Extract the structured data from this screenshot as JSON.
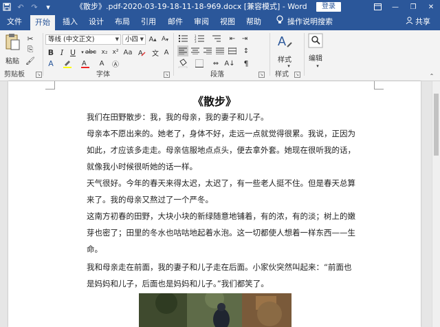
{
  "titlebar": {
    "title": "《散步》.pdf-2020-03-19-18-11-18-969.docx [兼容模式] - Word",
    "login_label": "登录",
    "colors": {
      "brand": "#2b579a"
    }
  },
  "tabs": [
    "文件",
    "开始",
    "插入",
    "设计",
    "布局",
    "引用",
    "邮件",
    "审阅",
    "视图",
    "帮助"
  ],
  "tell_me": "操作说明搜索",
  "share": "共享",
  "ribbon": {
    "clipboard": {
      "paste": "粘贴",
      "label": "剪贴板"
    },
    "font": {
      "name": "等线 (中文正文)",
      "size": "小四",
      "label": "字体"
    },
    "paragraph": {
      "label": "段落"
    },
    "styles": {
      "button": "样式",
      "label": "样式"
    },
    "editing": {
      "button": "编辑"
    }
  },
  "document": {
    "title": "《散步》",
    "paragraphs": [
      "我们在田野散步：我，我的母亲，我的妻子和儿子。",
      "母亲本不愿出来的。她老了，身体不好，走远一点就觉得很累。我说，正因为如此，才应该多走走。母亲信服地点点头，便去拿外套。她现在很听我的话，就像我小时候很听她的话一样。",
      "天气很好。今年的春天来得太迟，太迟了，有一些老人挺不住。但是春天总算来了。我的母亲又熬过了一个严冬。",
      "这南方初春的田野，大块小块的新绿随意地铺着，有的浓，有的淡；树上的嫩芽也密了；田里的冬水也咕咕地起着水泡。这一切都使人想着一样东西——生命。",
      "我和母亲走在前面，我的妻子和儿子走在后面。小家伙突然叫起来：“前面也是妈妈和儿子，后面也是妈妈和儿子。”我们都笑了。"
    ]
  }
}
